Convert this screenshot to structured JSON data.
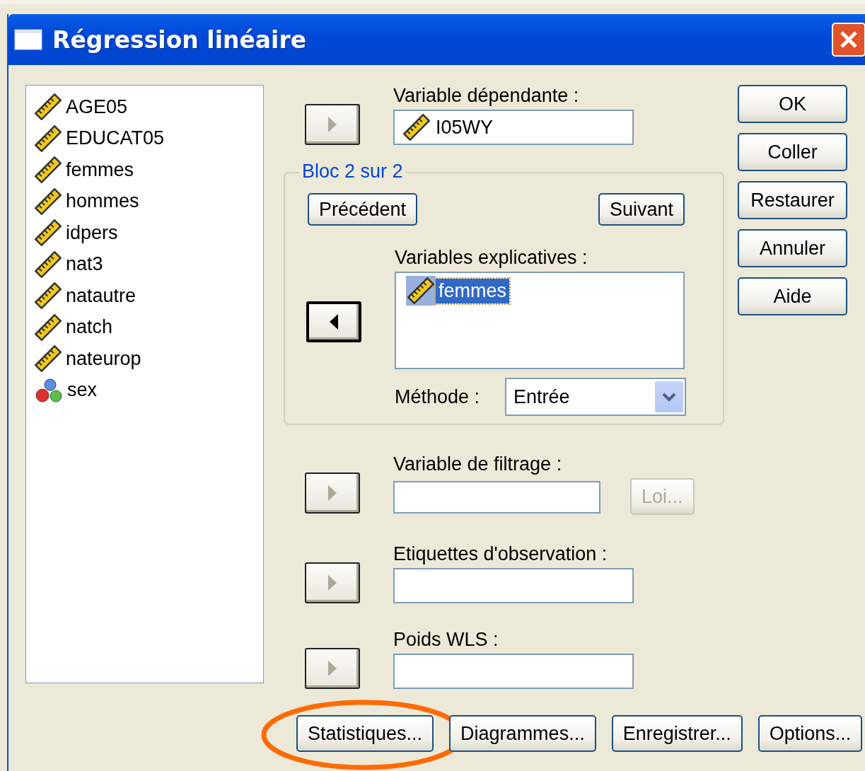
{
  "window": {
    "title": "Régression linéaire"
  },
  "variables": [
    {
      "name": "AGE05",
      "kind": "scale"
    },
    {
      "name": "EDUCAT05",
      "kind": "scale"
    },
    {
      "name": "femmes",
      "kind": "scale"
    },
    {
      "name": "hommes",
      "kind": "scale"
    },
    {
      "name": "idpers",
      "kind": "scale"
    },
    {
      "name": "nat3",
      "kind": "scale"
    },
    {
      "name": "natautre",
      "kind": "scale"
    },
    {
      "name": "natch",
      "kind": "scale"
    },
    {
      "name": "nateurop",
      "kind": "scale"
    },
    {
      "name": "sex",
      "kind": "nominal"
    }
  ],
  "dependent": {
    "label": "Variable dépendante :",
    "value": "I05WY",
    "kind": "scale",
    "move_button": {
      "kind": "right",
      "focused": false
    }
  },
  "block": {
    "legend": "Bloc 2 sur 2",
    "previous": "Précédent",
    "next": "Suivant",
    "independents_label": "Variables explicatives :",
    "move_button": {
      "kind": "left",
      "focused": true
    },
    "independents": [
      {
        "name": "femmes",
        "kind": "scale",
        "selected": true
      }
    ],
    "method_label": "Méthode :",
    "method": "Entrée"
  },
  "filter": {
    "label": "Variable de filtrage :",
    "move_button": {
      "kind": "right",
      "focused": false
    },
    "rule_button": {
      "label": "Loi...",
      "disabled": true
    }
  },
  "case_labels": {
    "label": "Etiquettes d'observation :",
    "move_button": {
      "kind": "right",
      "focused": false
    }
  },
  "wls": {
    "label": "Poids WLS :",
    "move_button": {
      "kind": "right",
      "focused": false
    }
  },
  "side_buttons": [
    "OK",
    "Coller",
    "Restaurer",
    "Annuler",
    "Aide"
  ],
  "bottom_buttons": [
    {
      "label": "Statistiques...",
      "highlighted": true
    },
    {
      "label": "Diagrammes...",
      "highlighted": false
    },
    {
      "label": "Enregistrer...",
      "highlighted": false
    },
    {
      "label": "Options...",
      "highlighted": false
    }
  ]
}
